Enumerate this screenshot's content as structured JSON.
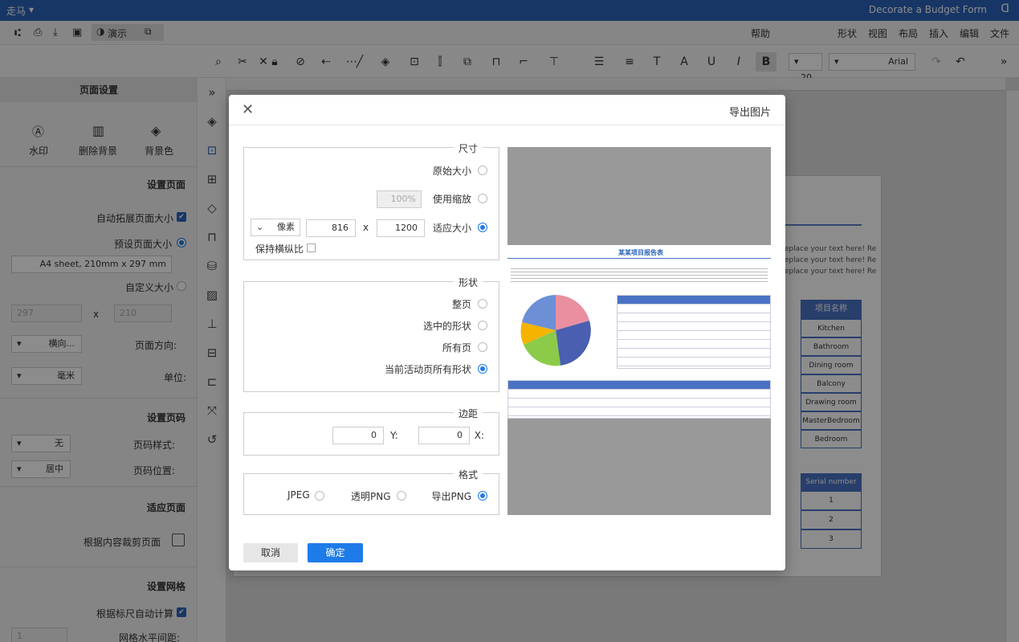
{
  "titlebar": {
    "app_name": "走马",
    "doc_title": "Decorate a Budget Form"
  },
  "menu": [
    "文件",
    "编辑",
    "插入",
    "布局",
    "视图",
    "形状",
    "帮助"
  ],
  "quick": {
    "present_label": "演示"
  },
  "toolbar": {
    "font_name": "Arial",
    "font_size": "20"
  },
  "left_panel": {
    "header": "页面设置",
    "top_actions": [
      "背景色",
      "删除背景",
      "水印"
    ],
    "page_section_title": "设置页面",
    "auto_expand_label": "自动拓展页面大小",
    "preset_size_label": "预设页面大小",
    "preset_size_value": "A4 sheet, 210mm x 297 mm",
    "custom_size_label": "自定义大小",
    "custom_w": "210",
    "custom_h": "297",
    "custom_x": "x",
    "orientation_label": "页面方向:",
    "orientation_value": "横向...",
    "unit_label": "单位:",
    "unit_value": "毫米",
    "pagenum_section_title": "设置页码",
    "pagenum_style_label": "页码样式:",
    "pagenum_style_value": "无",
    "pagenum_pos_label": "页码位置:",
    "pagenum_pos_value": "居中",
    "fit_section_title": "适应页面",
    "fit_content_label": "根据内容裁剪页面",
    "grid_section_title": "设置网格",
    "grid_auto_label": "根据标尺自动计算",
    "grid_h_label": "网格水平间距:",
    "grid_h_value": "1"
  },
  "dialog": {
    "title": "导出图片",
    "size_group": "尺寸",
    "size_opts": [
      "原始大小",
      "使用缩放",
      "适应大小"
    ],
    "zoom_value": "100%",
    "width_value": "1200",
    "x_sep": "x",
    "height_value": "816",
    "unit_value": "像素",
    "keep_ratio_label": "保持横纵比",
    "shape_group": "形状",
    "shape_opts": [
      "整页",
      "选中的形状",
      "所有页",
      "当前活动页所有形状"
    ],
    "margin_group": "边距",
    "margin_x_label": "X:",
    "margin_x_value": "0",
    "margin_y_label": "Y:",
    "margin_y_value": "0",
    "format_group": "格式",
    "format_opts": [
      "导出PNG",
      "透明PNG",
      "JPEG"
    ],
    "ok_label": "确定",
    "cancel_label": "取消",
    "preview_title": "某某项目报告表"
  },
  "canvas": {
    "table_header": "项目名称",
    "rows": [
      "Kitchen",
      "Bathroom",
      "Dining room",
      "Balcony",
      "Drawing room",
      "MasterBedroom",
      "Bedroom"
    ],
    "serial_header": "Serial number",
    "serial_rows": [
      "1",
      "2",
      "3"
    ],
    "text_lines": [
      "Replace your text here! Re",
      "Replace your text here! Re",
      "Replace your text here! Re"
    ]
  },
  "colors": {
    "accent": "#1e7ce8",
    "titlebar": "#2a63b8"
  }
}
